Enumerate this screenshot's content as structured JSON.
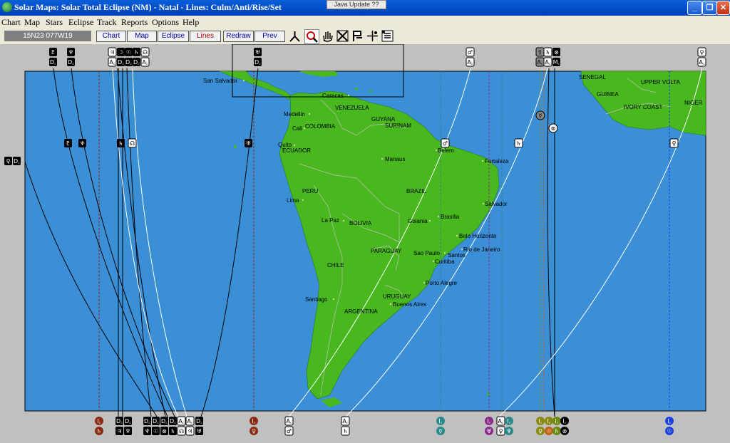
{
  "window": {
    "title": "Solar Maps: Solar Total Eclipse (NM) - Natal - Lines: Culm/Anti/Rise/Set",
    "tooltip": "Java Update ??",
    "minimize_glyph": "_",
    "maximize_glyph": "❐",
    "close_glyph": "✕"
  },
  "menu": [
    "Chart",
    "Map",
    "Stars",
    "Eclipse",
    "Track",
    "Reports",
    "Options",
    "Help"
  ],
  "toolbar": {
    "coordinates": "15N23 077W19",
    "buttons": [
      "Chart",
      "Map",
      "Eclipse",
      "Lines",
      "Redraw",
      "Prev"
    ],
    "tools": [
      "person-tool-icon",
      "zoom-tool-icon",
      "hand-tool-icon",
      "cross-tool-icon",
      "flag-tool-icon",
      "crosshair-tool-icon",
      "info-tool-icon"
    ]
  },
  "map": {
    "colors": {
      "ocean": "#3a8fd6",
      "land": "#48b81e",
      "border": "#c0c0c0",
      "frame": "#000000"
    },
    "countries": [
      "VENEZUELA",
      "GUYANA",
      "SURINAM",
      "COLOMBIA",
      "ECUADOR",
      "PERU",
      "BRAZIL",
      "BOLIVIA",
      "PARAGUAY",
      "CHILE",
      "URUGUAY",
      "ARGENTINA",
      "SENEGAL",
      "GUINEA",
      "UPPER VOLTA",
      "IVORY COAST",
      "NIGER"
    ],
    "cities": [
      "San Salvador",
      "Caracas",
      "Medellin",
      "Cali",
      "Quito",
      "Manaus",
      "Belem",
      "Fortaleza",
      "Lima",
      "La Paz",
      "Salvador",
      "Brasilia",
      "Goiania",
      "Belo Horizonte",
      "Rio de Janeiro",
      "Sao Paulo",
      "Santos",
      "Curitiba",
      "Porto Alegre",
      "Santiago",
      "Buenos Aires"
    ],
    "top_markers": [
      {
        "planet": "♇",
        "angle": "D꜀"
      },
      {
        "planet": "♆",
        "angle": "D꜀"
      },
      {
        "planet": "♃",
        "angle": "A꜀"
      },
      {
        "planet": "☽",
        "angle": "D꜀"
      },
      {
        "planet": "☉",
        "angle": "D꜀"
      },
      {
        "planet": "♄",
        "angle": "D꜀"
      },
      {
        "planet": "☊",
        "angle": "A꜀"
      },
      {
        "planet": "♅",
        "angle": "D꜀"
      },
      {
        "planet": "♂",
        "angle": "A꜀"
      },
      {
        "planet": "☿",
        "angle": "A꜀"
      },
      {
        "planet": "♄",
        "angle": "A꜀"
      },
      {
        "planet": "⊗",
        "angle": "M꜀"
      },
      {
        "planet": "♀",
        "angle": "A꜀"
      }
    ],
    "bottom_markers": [
      {
        "top": "I꜀",
        "bottom": "♄"
      },
      {
        "top": "D꜀",
        "bottom": "♃"
      },
      {
        "top": "D꜀",
        "bottom": "♆"
      },
      {
        "top": "I꜀",
        "bottom": "♀"
      },
      {
        "top": "A꜀",
        "bottom": "♂"
      },
      {
        "top": "A꜀",
        "bottom": "♄"
      },
      {
        "top": "I꜀",
        "bottom": "☿"
      },
      {
        "top": "I꜀",
        "bottom": "♅"
      },
      {
        "top": "A꜀",
        "bottom": "♀"
      },
      {
        "top": "I꜀",
        "bottom": "♆"
      },
      {
        "top": "I꜀",
        "bottom": "☉"
      }
    ]
  }
}
